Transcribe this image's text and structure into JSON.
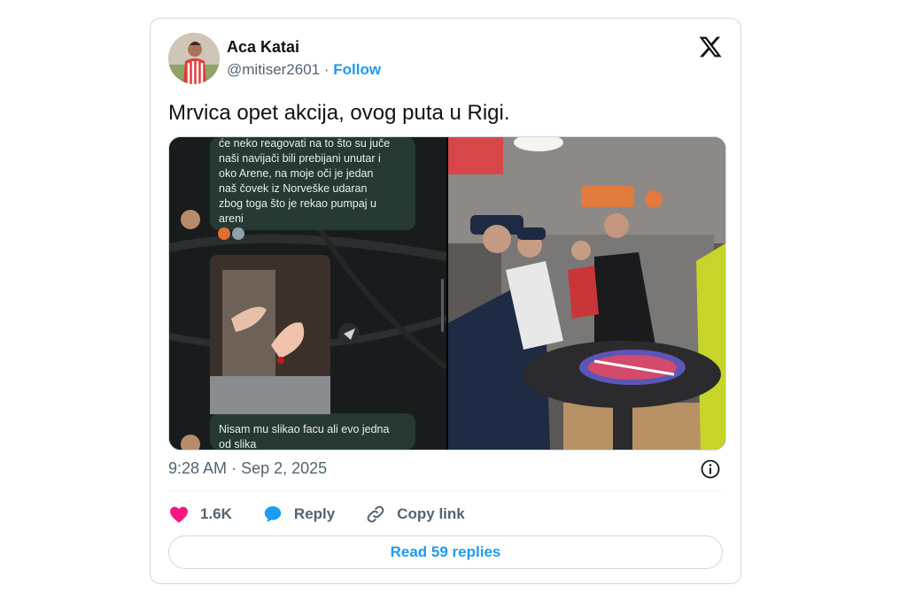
{
  "author": {
    "name": "Aca Katai",
    "handle": "@mitiser2601",
    "separator": "·",
    "follow_label": "Follow"
  },
  "tweet": {
    "text": "Mrvica opet akcija, ovog puta u Rigi."
  },
  "media": {
    "screenshot_message_1": [
      "će neko reagovati na to što su juče",
      "naši navijači bili prebijani unutar i",
      "oko Arene, na moje oči je jedan",
      "naš čovek iz Norveške udaran",
      "zbog toga što je rekao pumpaj u",
      "areni"
    ],
    "screenshot_message_2": [
      "Nisam mu slikao facu ali evo jedna",
      "od slika"
    ]
  },
  "meta": {
    "time": "9:28 AM",
    "separator": "·",
    "date": "Sep 2, 2025"
  },
  "actions": {
    "likes": "1.6K",
    "reply_label": "Reply",
    "copy_link_label": "Copy link"
  },
  "read_replies_label": "Read 59 replies",
  "colors": {
    "accent": "#1d9bf0",
    "like": "#f91880",
    "muted": "#536471"
  }
}
